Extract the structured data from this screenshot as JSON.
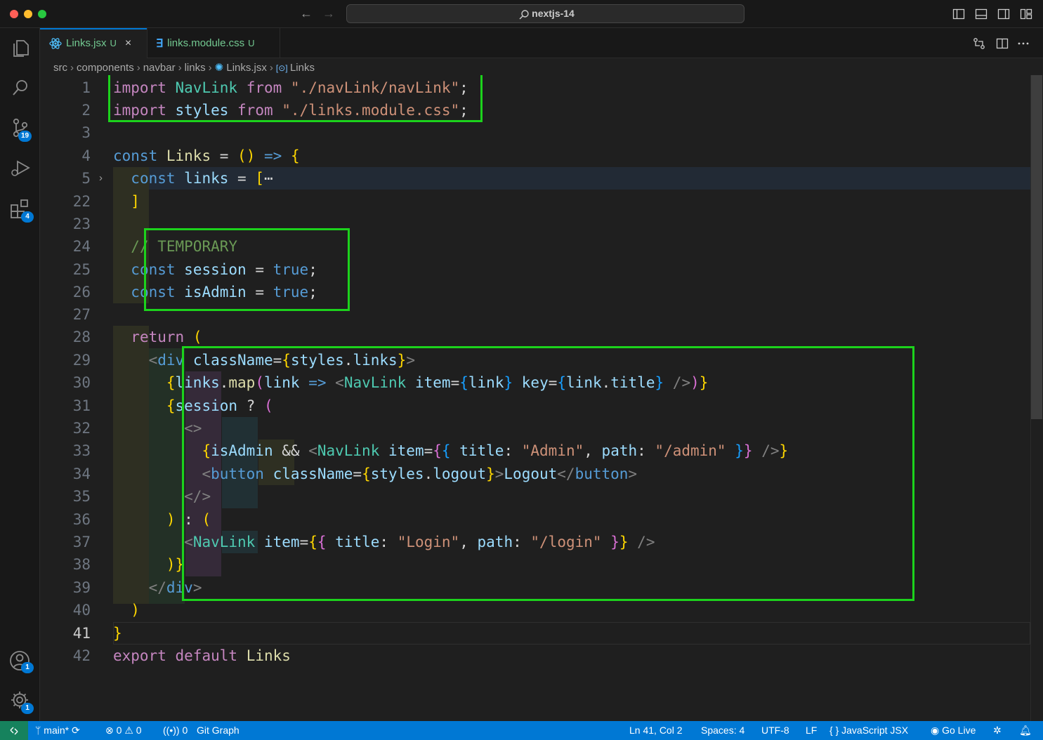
{
  "window": {
    "title": "nextjs-14"
  },
  "activity": {
    "source_control_badge": "19",
    "extensions_badge": "4",
    "accounts_badge": "1",
    "settings_badge": "1"
  },
  "tabs": [
    {
      "label": "Links.jsx",
      "status": "U",
      "close": "×"
    },
    {
      "label": "links.module.css",
      "status": "U"
    }
  ],
  "breadcrumbs": [
    "src",
    "components",
    "navbar",
    "links",
    "Links.jsx",
    "Links"
  ],
  "editor": {
    "line_numbers": [
      "1",
      "2",
      "3",
      "4",
      "5",
      "22",
      "23",
      "24",
      "25",
      "26",
      "27",
      "28",
      "29",
      "30",
      "31",
      "32",
      "33",
      "34",
      "35",
      "36",
      "37",
      "38",
      "39",
      "40",
      "41",
      "42"
    ],
    "current_line": "41",
    "lines": [
      "import NavLink from \"./navLink/navLink\";",
      "import styles from \"./links.module.css\";",
      "",
      "const Links = () => {",
      "  const links = [⋯",
      "  ]",
      "",
      "  // TEMPORARY",
      "  const session = true;",
      "  const isAdmin = true;",
      "",
      "  return (",
      "    <div className={styles.links}>",
      "      {links.map(link => <NavLink item={link} key={link.title} />)}",
      "      {session ? (",
      "        <>",
      "          {isAdmin && <NavLink item={{ title: \"Admin\", path: \"/admin\" }} />}",
      "          <button className={styles.logout}>Logout</button>",
      "        </>",
      "      ) : (",
      "        <NavLink item={{ title: \"Login\", path: \"/login\" }} />",
      "      )}",
      "    </div>",
      "  )",
      "}",
      "export default Links"
    ]
  },
  "statusbar": {
    "branch": "main*",
    "errors": "0",
    "warnings": "0",
    "ports": "0",
    "git_graph": "Git Graph",
    "cursor": "Ln 41, Col 2",
    "spaces": "Spaces: 4",
    "encoding": "UTF-8",
    "eol": "LF",
    "language": "JavaScript JSX",
    "go_live": "Go Live"
  },
  "colors": {
    "accent": "#0078d4",
    "highlight_box": "#1cd21c",
    "untracked_file": "#73c991"
  }
}
